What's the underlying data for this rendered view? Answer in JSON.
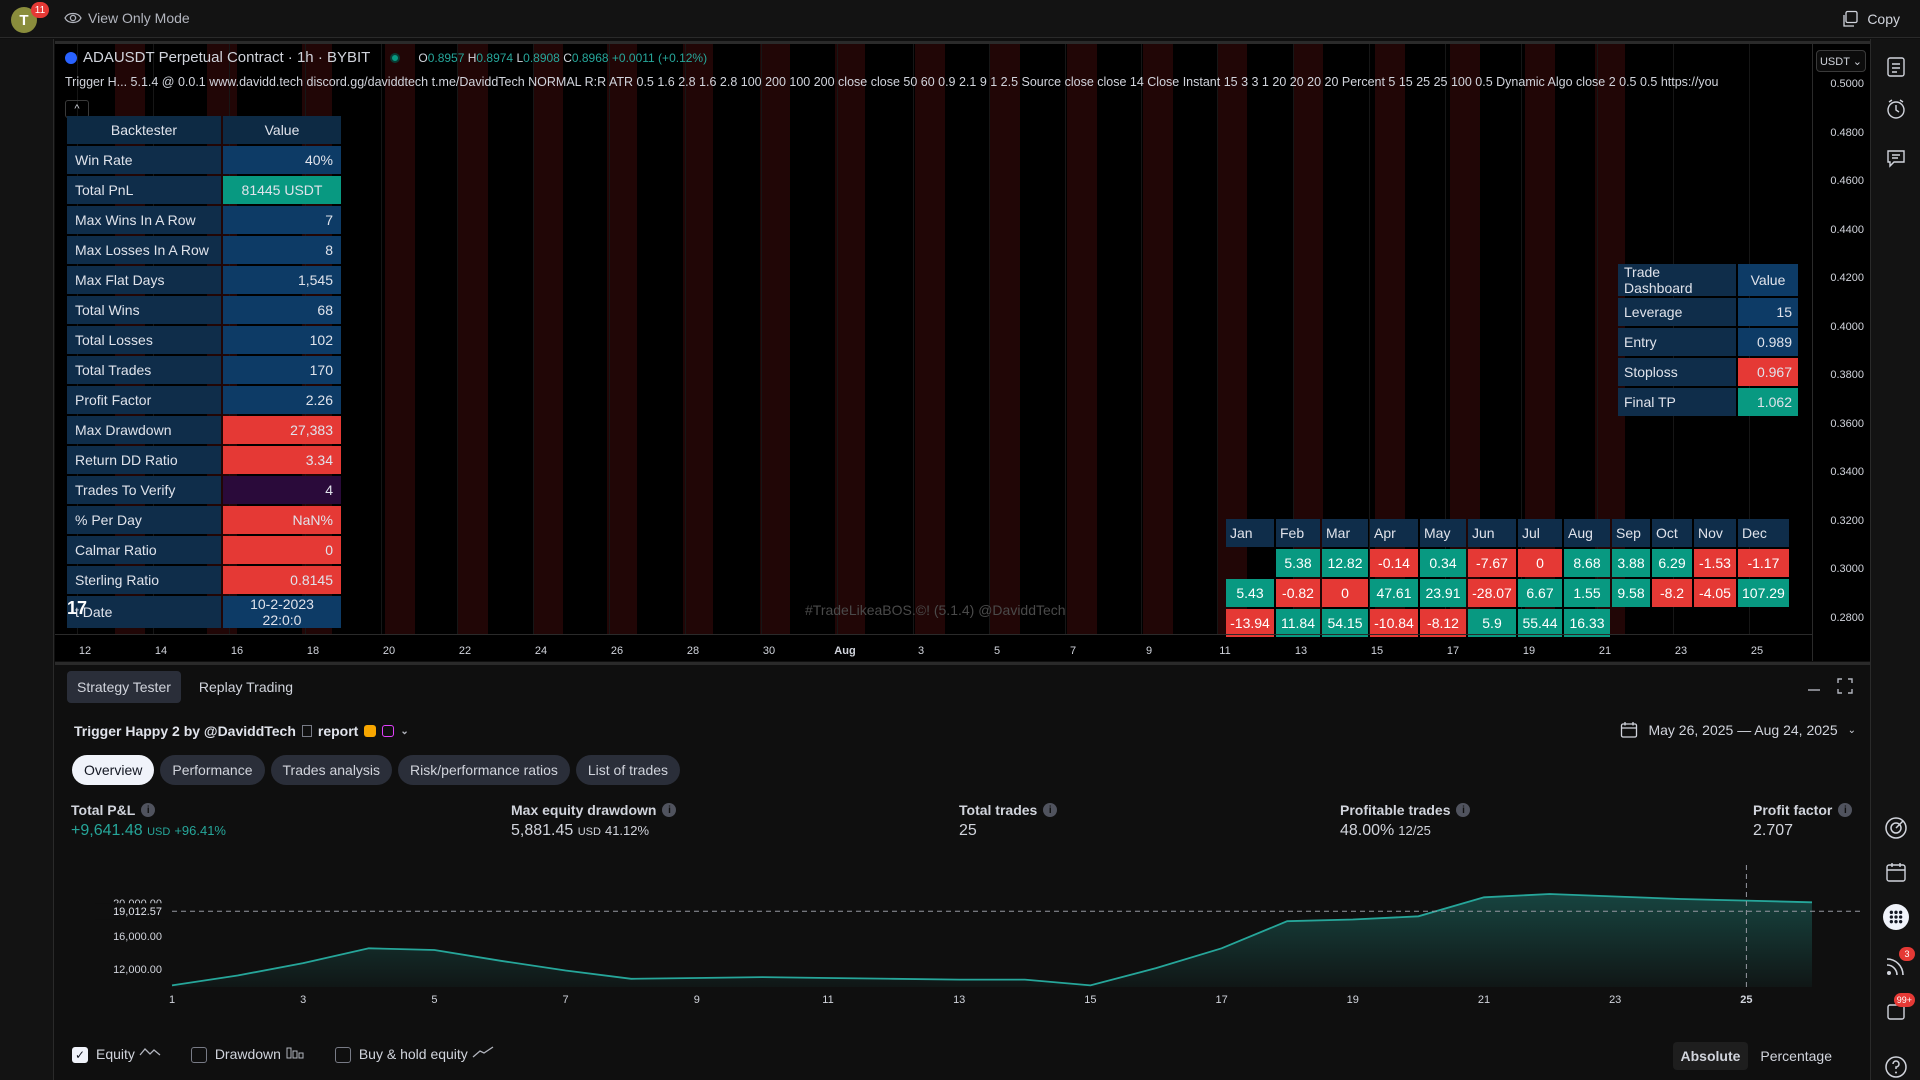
{
  "topbar": {
    "avatar_letter": "T",
    "avatar_badge": "11",
    "view_only": "View Only Mode",
    "copy": "Copy"
  },
  "chart": {
    "symbol": "ADAUSDT Perpetual Contract · 1h · BYBIT",
    "ohlc": {
      "o_label": "O",
      "o": "0.8957",
      "h_label": "H",
      "h": "0.8974",
      "l_label": "L",
      "l": "0.8908",
      "c_label": "C",
      "c": "0.8968",
      "change": "+0.0011 (+0.12%)"
    },
    "indicator_line": "Trigger H...  5.1.4 @ 0.0.1 www.davidd.tech discord.gg/daviddtech t.me/DaviddTech NORMAL R:R ATR 0.5 1.6 2.8 1.6 2.8 100 200 100 200 close close 50 60 0.9 2.1 9 1 2.5 Source close close 14 Close Instant 15 3 3 1 20 20 20 20 Percent 5 15 25 25 100 0.5 Dynamic Algo close 2 0.5 0.5 https://you",
    "collapse": "^",
    "currency_btn": "USDT ⌄",
    "price_labels": [
      "0.5000",
      "0.4800",
      "0.4600",
      "0.4400",
      "0.4200",
      "0.4000",
      "0.3800",
      "0.3600",
      "0.3400",
      "0.3200",
      "0.3000",
      "0.2800"
    ],
    "time_labels": [
      "12",
      "14",
      "16",
      "18",
      "20",
      "22",
      "24",
      "26",
      "28",
      "30",
      "Aug",
      "3",
      "5",
      "7",
      "9",
      "11",
      "13",
      "15",
      "17",
      "19",
      "21",
      "23",
      "25"
    ],
    "watermark": "#TradeLikeaBOS.©! (5.1.4) @DaviddTech",
    "tv_logo": "17"
  },
  "backtester": {
    "header": [
      "Backtester",
      "Value"
    ],
    "rows": [
      {
        "k": "Win Rate",
        "v": "40%",
        "style": ""
      },
      {
        "k": "Total PnL",
        "v": "81445 USDT",
        "style": "green"
      },
      {
        "k": "Max Wins In A Row",
        "v": "7",
        "style": ""
      },
      {
        "k": "Max Losses In A Row",
        "v": "8",
        "style": ""
      },
      {
        "k": "Max Flat Days",
        "v": "1,545",
        "style": ""
      },
      {
        "k": "Total Wins",
        "v": "68",
        "style": ""
      },
      {
        "k": "Total Losses",
        "v": "102",
        "style": ""
      },
      {
        "k": "Total Trades",
        "v": "170",
        "style": ""
      },
      {
        "k": "Profit Factor",
        "v": "2.26",
        "style": ""
      },
      {
        "k": "Max Drawdown",
        "v": "27,383",
        "style": "red"
      },
      {
        "k": "Return DD Ratio",
        "v": "3.34",
        "style": "red"
      },
      {
        "k": "Trades To Verify",
        "v": "4",
        "style": "purple"
      },
      {
        "k": "% Per Day",
        "v": "NaN%",
        "style": "red"
      },
      {
        "k": "Calmar Ratio",
        "v": "0",
        "style": "red"
      },
      {
        "k": "Sterling Ratio",
        "v": "0.8145",
        "style": "red"
      },
      {
        "k": "t Date",
        "v": "10-2-2023 22:0:0",
        "style": "center"
      }
    ]
  },
  "trade_dashboard": {
    "header": [
      "Trade Dashboard",
      "Value"
    ],
    "rows": [
      {
        "k": "Leverage",
        "v": "15",
        "style": ""
      },
      {
        "k": "Entry",
        "v": "0.989",
        "style": ""
      },
      {
        "k": "Stoploss",
        "v": "0.967",
        "style": "red"
      },
      {
        "k": "Final TP",
        "v": "1.062",
        "style": "green"
      }
    ]
  },
  "monthly": {
    "months": [
      "Jan",
      "Feb",
      "Mar",
      "Apr",
      "May",
      "Jun",
      "Jul",
      "Aug",
      "Sep",
      "Oct",
      "Nov",
      "Dec"
    ],
    "rows": [
      [
        "",
        "5.38",
        "12.82",
        "-0.14",
        "0.34",
        "-7.67",
        "0",
        "8.68",
        "3.88",
        "6.29",
        "-1.53",
        "-1.17"
      ],
      [
        "5.43",
        "-0.82",
        "0",
        "47.61",
        "23.91",
        "-28.07",
        "6.67",
        "1.55",
        "9.58",
        "-8.2",
        "-4.05",
        "107.29"
      ],
      [
        "-13.94",
        "11.84",
        "54.15",
        "-10.84",
        "-8.12",
        "5.9",
        "55.44",
        "16.33",
        "",
        "",
        "",
        ""
      ]
    ],
    "colors": [
      [
        "e",
        "g",
        "g",
        "r",
        "g",
        "r",
        "r",
        "g",
        "g",
        "g",
        "r",
        "r"
      ],
      [
        "g",
        "r",
        "r",
        "g",
        "g",
        "r",
        "g",
        "g",
        "g",
        "r",
        "r",
        "g"
      ],
      [
        "r",
        "g",
        "g",
        "r",
        "r",
        "g",
        "g",
        "g",
        "e",
        "e",
        "e",
        "e"
      ]
    ]
  },
  "panel": {
    "tabs": [
      "Strategy Tester",
      "Replay Trading"
    ],
    "strategy_title": "Trigger Happy 2 by @DaviddTech",
    "report": "report",
    "date_range": "May 26, 2025 — Aug 24, 2025",
    "subtabs": [
      "Overview",
      "Performance",
      "Trades analysis",
      "Risk/performance ratios",
      "List of trades"
    ],
    "metrics": {
      "pnl": {
        "label": "Total P&L",
        "value": "+9,641.48",
        "unit": "USD",
        "sub": "+96.41%"
      },
      "drawdown": {
        "label": "Max equity drawdown",
        "value": "5,881.45",
        "unit": "USD",
        "sub": "41.12%"
      },
      "trades": {
        "label": "Total trades",
        "value": "25"
      },
      "profitable": {
        "label": "Profitable trades",
        "value": "48.00%",
        "sub": "12/25"
      },
      "pf": {
        "label": "Profit factor",
        "value": "2.707"
      }
    },
    "legend": {
      "equity": "Equity",
      "drawdown": "Drawdown",
      "buyhold": "Buy & hold equity"
    },
    "abs": "Absolute",
    "pct": "Percentage"
  },
  "chart_data": {
    "type": "area",
    "x": [
      0,
      1,
      2,
      3,
      4,
      5,
      6,
      7,
      8,
      9,
      10,
      11,
      12,
      13,
      14,
      15,
      16,
      17,
      18,
      19,
      20,
      21,
      22,
      23,
      24,
      25
    ],
    "series": [
      {
        "values": [
          10000,
          11200,
          12700,
          14500,
          14300,
          13000,
          11800,
          10800,
          10900,
          11000,
          10900,
          10800,
          10700,
          10700,
          10000,
          12100,
          14500,
          17800,
          18000,
          18400,
          20700,
          21100,
          20800,
          20500,
          20300,
          20100
        ]
      }
    ],
    "x_tick_labels": [
      "1",
      "3",
      "5",
      "7",
      "9",
      "11",
      "13",
      "15",
      "17",
      "19",
      "21",
      "23",
      "25"
    ],
    "y_tick_labels": [
      "20,000.00",
      "16,000.00",
      "12,000.00"
    ],
    "marker_value": "19,012.57",
    "ylim": [
      9800,
      22200
    ],
    "color": "#26a69a"
  }
}
